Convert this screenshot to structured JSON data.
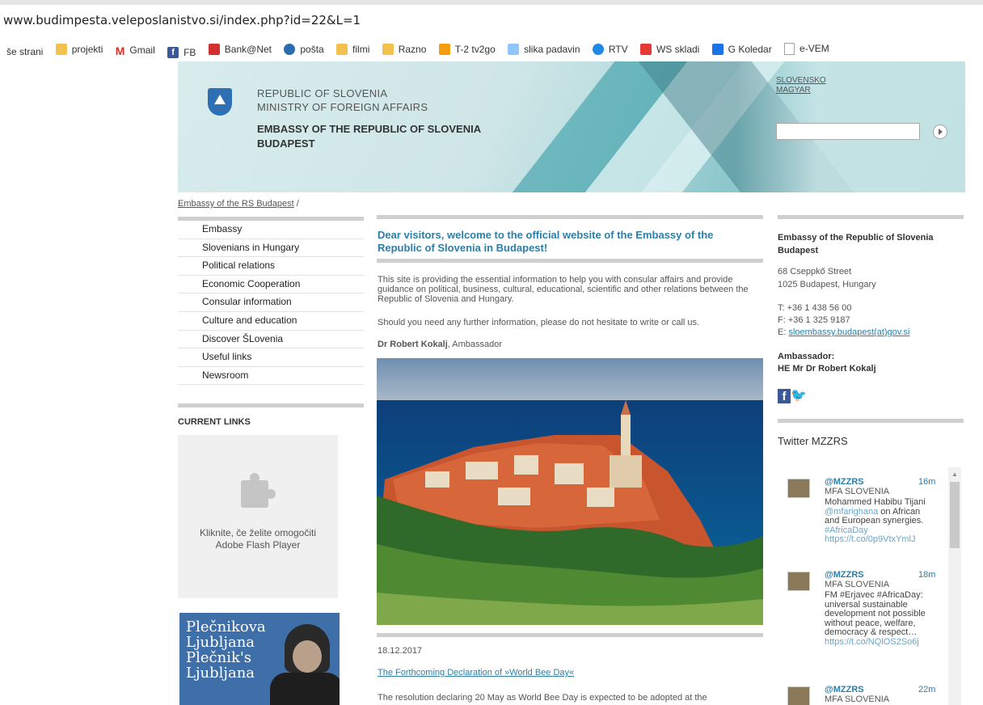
{
  "browser": {
    "url": "www.budimpesta.veleposlanistvo.si/index.php?id=22&L=1",
    "bookmarks": [
      {
        "label": "še strani",
        "icon": "none"
      },
      {
        "label": "projekti",
        "icon": "folder-icon",
        "color": "#f2c14e"
      },
      {
        "label": "Gmail",
        "icon": "gmail-icon",
        "color": "#d93025"
      },
      {
        "label": "FB",
        "icon": "facebook-icon",
        "color": "#3b5998"
      },
      {
        "label": "Bank@Net",
        "icon": "bank-icon",
        "color": "#d32f2f"
      },
      {
        "label": "pošta",
        "icon": "mail-icon",
        "color": "#2b6cb0"
      },
      {
        "label": "filmi",
        "icon": "folder-icon",
        "color": "#f2c14e"
      },
      {
        "label": "Razno",
        "icon": "folder-icon",
        "color": "#f2c14e"
      },
      {
        "label": "T-2 tv2go",
        "icon": "tv-icon",
        "color": "#f59e0b"
      },
      {
        "label": "slika padavin",
        "icon": "weather-icon",
        "color": "#3b82f6"
      },
      {
        "label": "RTV",
        "icon": "rtv-icon",
        "color": "#1e88e5"
      },
      {
        "label": "WS skladi",
        "icon": "ws-icon",
        "color": "#e53935"
      },
      {
        "label": "G Koledar",
        "icon": "calendar-icon",
        "color": "#1a73e8"
      },
      {
        "label": "e-VEM",
        "icon": "document-icon",
        "color": "#9ca3af"
      }
    ]
  },
  "header": {
    "line1": "REPUBLIC OF SLOVENIA",
    "line2": "MINISTRY OF FOREIGN AFFAIRS",
    "embassy1": "EMBASSY OF THE REPUBLIC OF SLOVENIA",
    "embassy2": "BUDAPEST",
    "lang1": "SLOVENSKO",
    "lang2": "MAGYAR"
  },
  "breadcrumb": {
    "link": "Embassy of the RS Budapest",
    "sep": " /"
  },
  "nav": [
    "Embassy",
    "Slovenians in Hungary",
    "Political relations",
    "Economic Cooperation",
    "Consular information",
    "Culture and education",
    "Discover ŠLovenia",
    "Useful links",
    "Newsroom"
  ],
  "sidebar": {
    "current_links": "CURRENT LINKS",
    "flash_line1": "Kliknite, če želite omogočiti",
    "flash_line2": "Adobe Flash Player",
    "banner_lines": [
      "Plečnikova",
      "Ljubljana",
      "Plečnik's",
      "Ljubljana"
    ]
  },
  "main": {
    "title": "Dear visitors, welcome to the official website of the Embassy of the Republic of Slovenia in Budapest!",
    "para1": "This site is providing the essential information to help you with consular affairs and provide guidance on political, business, cultural, educational, scientific and other relations between the Republic of Slovenia and Hungary.",
    "para2": "Should you need any further information, please do not hesitate to write or call us.",
    "ambassador_name": "Dr Robert Kokalj",
    "ambassador_role": ", Ambassador",
    "news_date": "18.12.2017",
    "news_title": "The Forthcoming Declaration of »World Bee Day«",
    "news_snippet": "The resolution declaring 20 May as World Bee Day is expected to be adopted at the"
  },
  "contact": {
    "heading": "Embassy of the Republic of Slovenia Budapest",
    "addr1": "68 Cseppkő Street",
    "addr2": "1025 Budapest, Hungary",
    "tel": "T: +36 1 438 56 00",
    "fax": "F: +36 1 325 9187",
    "email_label": "E: ",
    "email": "sloembassy.budapest(at)gov.si",
    "amb_label": "Ambassador:",
    "amb_name": "HE Mr Dr Robert Kokalj"
  },
  "twitter": {
    "title": "Twitter MZZRS",
    "tweets": [
      {
        "handle": "@MZZRS",
        "time": "16m",
        "name": "MFA SLOVENIA",
        "body_a": "Mohammed Habibu Tijani ",
        "mention": "@mfarighana",
        "body_b": " on African and European synergies. ",
        "tag": "#AfricaDay",
        "link": "https://t.co/0p9VtxYmlJ"
      },
      {
        "handle": "@MZZRS",
        "time": "18m",
        "name": "MFA SLOVENIA",
        "body_a": "FM #Erjavec #AfricaDay: universal sustainable development not possible without peace, welfare, democracy & respect…",
        "mention": "",
        "body_b": "",
        "tag": "",
        "link": "https://t.co/NQlOS2So6j"
      },
      {
        "handle": "@MZZRS",
        "time": "22m",
        "name": "MFA SLOVENIA",
        "body_a": "",
        "mention": "",
        "body_b": "",
        "tag": "",
        "link": ""
      }
    ]
  }
}
